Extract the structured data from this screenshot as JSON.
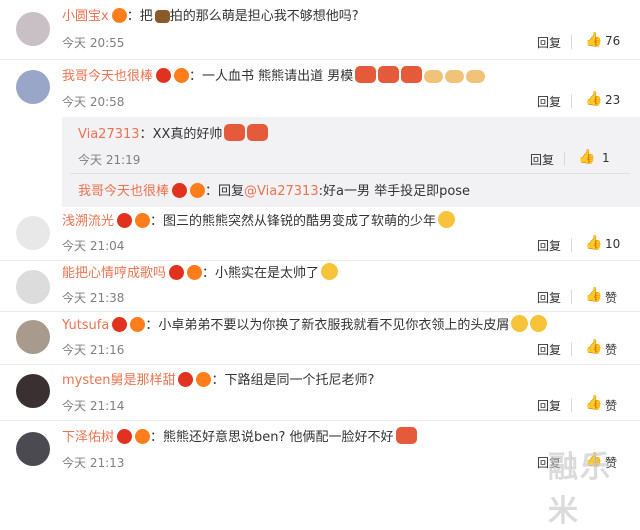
{
  "comments": [
    {
      "user": "小圆宝x",
      "text": "把",
      "text2": "拍的那么萌是担心我不够想他吗?",
      "time": "今天 20:55",
      "reply": "回复",
      "likes": "76",
      "avatar_color": "#c8c0c4"
    },
    {
      "user": "我哥今天也很棒",
      "text": "一人血书 熊熊请出道 男模",
      "time": "今天 20:58",
      "reply": "回复",
      "likes": "23",
      "avatar_color": "#9aa6c8"
    },
    {
      "user": "浅溯流光",
      "text": "图三的熊熊突然从锋锐的酷男变成了软萌的少年",
      "time": "今天 21:04",
      "reply": "回复",
      "likes": "10",
      "avatar_color": "#e8e8e8"
    },
    {
      "user": "能把心情哼成歌吗",
      "text": "小熊实在是太帅了",
      "time": "今天 21:38",
      "reply": "回复",
      "likes": "赞",
      "avatar_color": "#dcdcdc"
    },
    {
      "user": "Yutsufa",
      "text": "小卓弟弟不要以为你换了新衣服我就看不见你衣领上的头皮屑",
      "time": "今天 21:16",
      "reply": "回复",
      "likes": "赞",
      "avatar_color": "#a89a8c"
    },
    {
      "user": "mysten舅是那样甜",
      "text": "下路组是同一个托尼老师?",
      "time": "今天 21:14",
      "reply": "回复",
      "likes": "赞",
      "avatar_color": "#3a3032"
    },
    {
      "user": "下泽佑树",
      "text": "熊熊还好意思说ben? 他俩配一脸好不好",
      "time": "今天 21:13",
      "reply": "回复",
      "likes": "赞",
      "avatar_color": "#4a4a50"
    }
  ],
  "subcomments": [
    {
      "user": "Via27313",
      "text": "XX真的好帅",
      "time": "今天 21:19",
      "reply": "回复",
      "likes": "1"
    },
    {
      "user": "我哥今天也很棒",
      "reply_prefix": "回复",
      "mention": "@Via27313",
      "text": ":好a一男 举手投足即pose"
    }
  ],
  "watermark": "融乐米"
}
